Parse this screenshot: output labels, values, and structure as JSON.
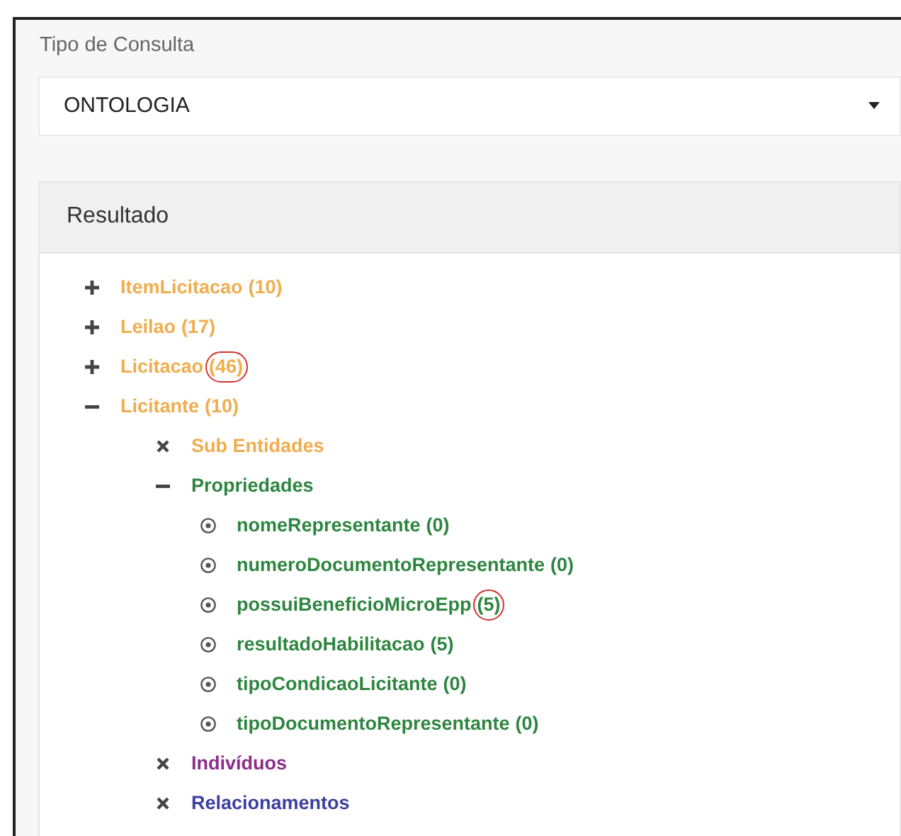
{
  "query_type": {
    "label": "Tipo de Consulta",
    "value": "ONTOLOGIA"
  },
  "panel": {
    "title": "Resultado"
  },
  "tree": [
    {
      "label": "ItemLicitacao",
      "count": "(10)",
      "kind": "branch",
      "expanded": false,
      "circled": false,
      "color": "#f0ad4e"
    },
    {
      "label": "Leilao",
      "count": "(17)",
      "kind": "branch",
      "expanded": false,
      "circled": false,
      "color": "#f0ad4e"
    },
    {
      "label": "Licitacao",
      "count": "(46)",
      "kind": "branch",
      "expanded": false,
      "circled": true,
      "color": "#f0ad4e"
    },
    {
      "label": "Licitante",
      "count": "(10)",
      "kind": "branch",
      "expanded": true,
      "circled": false,
      "color": "#f0ad4e",
      "children": [
        {
          "label": "Sub Entidades",
          "kind": "empty",
          "color": "#f0ad4e"
        },
        {
          "label": "Propriedades",
          "kind": "branch",
          "expanded": true,
          "color": "#2e8540",
          "children": [
            {
              "label": "nomeRepresentante",
              "count": "(0)",
              "kind": "leaf",
              "circled": false,
              "color": "#2e8540"
            },
            {
              "label": "numeroDocumentoRepresentante",
              "count": "(0)",
              "kind": "leaf",
              "circled": false,
              "color": "#2e8540"
            },
            {
              "label": "possuiBeneficioMicroEpp",
              "count": "(5)",
              "kind": "leaf",
              "circled": true,
              "color": "#2e8540"
            },
            {
              "label": "resultadoHabilitacao",
              "count": "(5)",
              "kind": "leaf",
              "circled": false,
              "color": "#2e8540"
            },
            {
              "label": "tipoCondicaoLicitante",
              "count": "(0)",
              "kind": "leaf",
              "circled": false,
              "color": "#2e8540"
            },
            {
              "label": "tipoDocumentoRepresentante",
              "count": "(0)",
              "kind": "leaf",
              "circled": false,
              "color": "#2e8540"
            }
          ]
        },
        {
          "label": "Indivíduos",
          "kind": "empty",
          "color": "#8b2d8b"
        },
        {
          "label": "Relacionamentos",
          "kind": "empty",
          "color": "#3b3f9e"
        }
      ]
    }
  ]
}
